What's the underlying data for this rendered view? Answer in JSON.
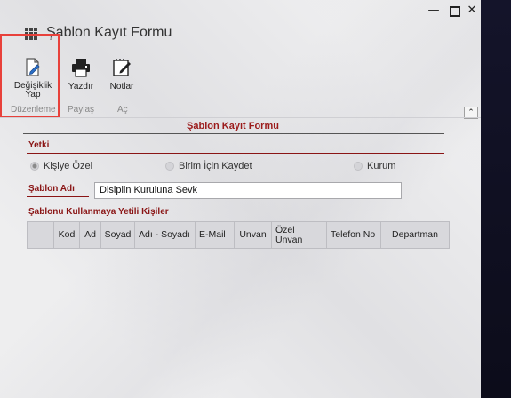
{
  "window": {
    "title": "Şablon Kayıt Formu",
    "controls": {
      "minimize": "—",
      "close": "✕"
    }
  },
  "ribbon": {
    "buttons": {
      "edit": "Değişiklik Yap",
      "print": "Yazdır",
      "notes": "Notlar"
    },
    "groups": {
      "edit": "Düzenleme",
      "share": "Paylaş",
      "open": "Aç"
    },
    "collapse": "⌃"
  },
  "form": {
    "title": "Şablon Kayıt Formu",
    "yetki_label": "Yetki",
    "radios": [
      {
        "label": "Kişiye Özel",
        "selected": true
      },
      {
        "label": "Birim İçin Kaydet",
        "selected": false
      },
      {
        "label": "Kurum",
        "selected": false
      }
    ],
    "sablon_adi_label": "Şablon Adı",
    "sablon_adi_value": "Disiplin Kuruluna Sevk",
    "persons_label": "Şablonu Kullanmaya Yetili Kişiler",
    "grid_columns": [
      "",
      "Kod",
      "Ad",
      "Soyad",
      "Adı - Soyadı",
      "E-Mail",
      "Unvan",
      "Özel Unvan",
      "Telefon No",
      "Departman"
    ]
  },
  "colors": {
    "accent_red": "#9b1b1b",
    "highlight": "#e8413b",
    "window_bg": "#e8e8ea"
  }
}
